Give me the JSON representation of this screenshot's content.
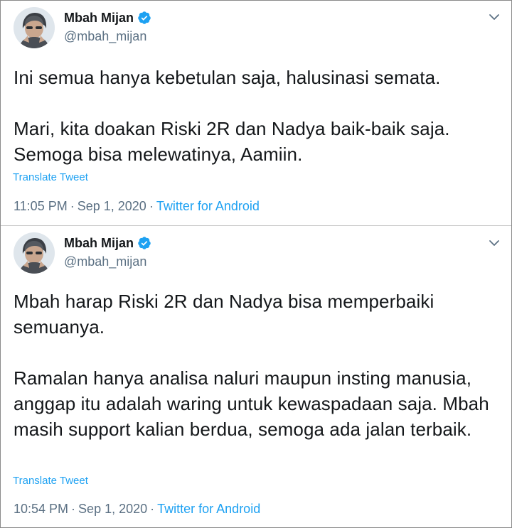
{
  "colors": {
    "link": "#1da1f2",
    "secondary_text": "#5b7083",
    "primary_text": "#14171a",
    "verified_badge": "#1da1f2"
  },
  "tweets": [
    {
      "author": {
        "display_name": "Mbah Mijan",
        "handle": "@mbah_mijan",
        "verified_icon": "verified-badge-icon",
        "avatar": "avatar"
      },
      "menu_icon": "chevron-down-icon",
      "text": "Ini semua hanya kebetulan saja, halusinasi semata.\n\nMari, kita doakan Riski 2R dan Nadya baik-baik saja. Semoga bisa melewatinya, Aamiin.",
      "translate_label": "Translate Tweet",
      "time": "11:05 PM",
      "separator": "·",
      "date": "Sep 1, 2020",
      "source": "Twitter for Android"
    },
    {
      "author": {
        "display_name": "Mbah Mijan",
        "handle": "@mbah_mijan",
        "verified_icon": "verified-badge-icon",
        "avatar": "avatar"
      },
      "menu_icon": "chevron-down-icon",
      "text": "Mbah harap Riski 2R dan Nadya bisa memperbaiki semuanya.\n\nRamalan hanya analisa naluri maupun insting manusia, anggap itu  adalah waring untuk kewaspadaan saja. Mbah masih support kalian berdua, semoga ada jalan terbaik.",
      "translate_label": "Translate Tweet",
      "time": "10:54 PM",
      "separator": "·",
      "date": "Sep 1, 2020",
      "source": "Twitter for Android"
    }
  ]
}
